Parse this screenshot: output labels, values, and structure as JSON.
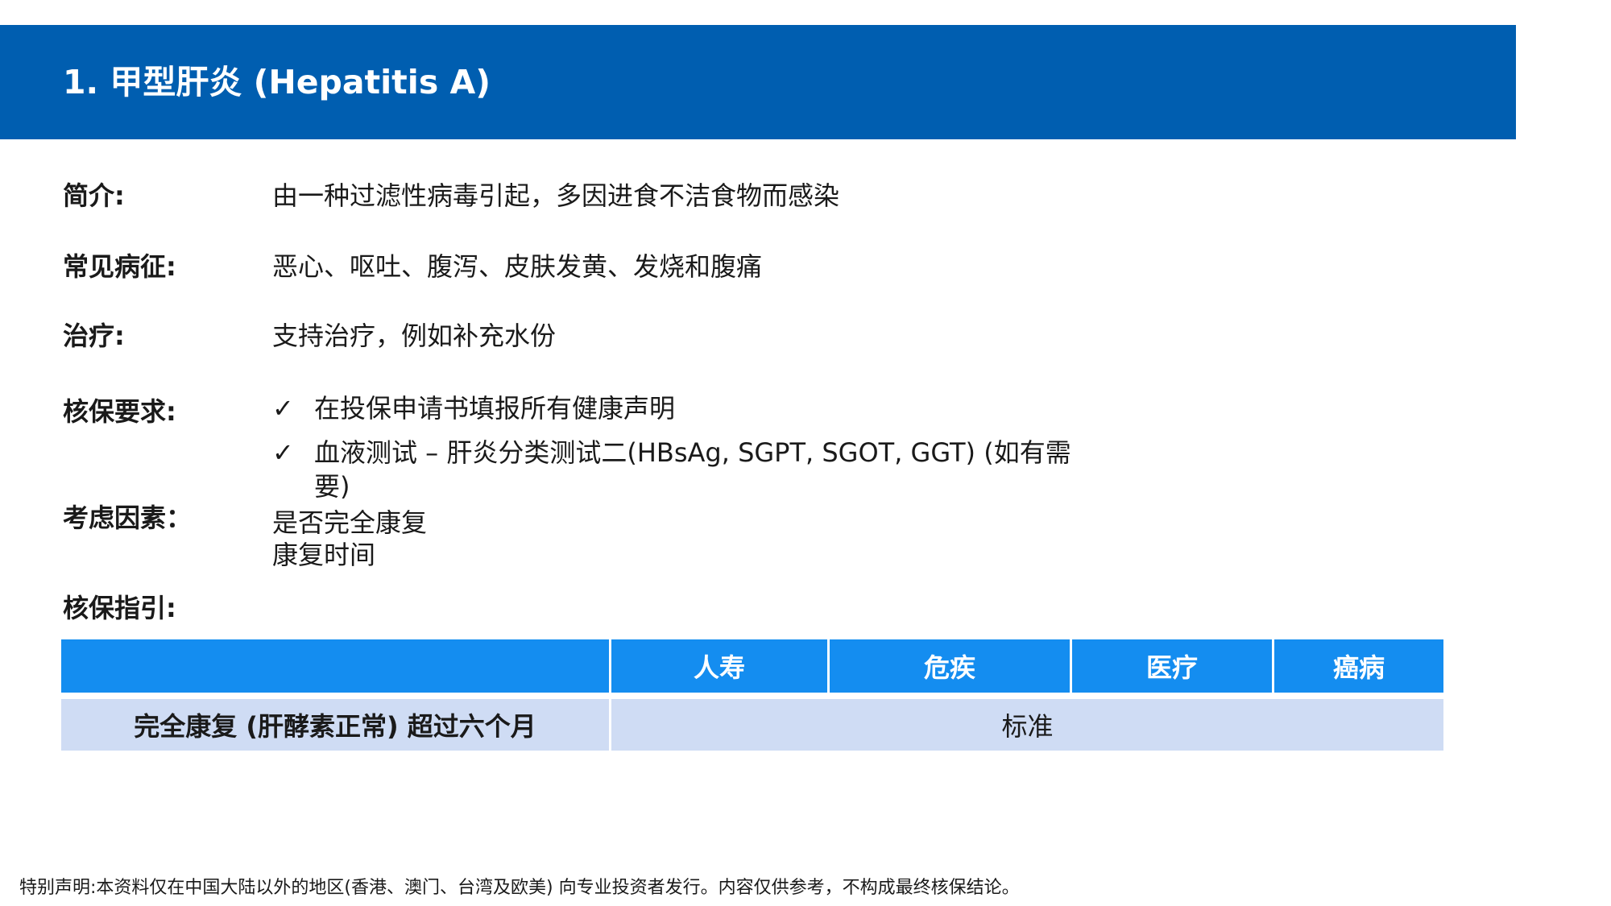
{
  "title": "1. 甲型肝炎 (Hepatitis A)",
  "sections": {
    "intro": {
      "label": "简介:",
      "value": "由一种过滤性病毒引起，多因进食不洁食物而感染"
    },
    "symptoms": {
      "label": "常见病征:",
      "value": "恶心、呕吐、腹泻、皮肤发黄、发烧和腹痛"
    },
    "treatment": {
      "label": "治疗:",
      "value": "支持治疗，例如补充水份"
    },
    "requirements": {
      "label": "核保要求:",
      "items": [
        "在投保申请书填报所有健康声明",
        "血液测试 – 肝炎分类测试二(HBsAg, SGPT, SGOT, GGT) (如有需要)"
      ]
    },
    "factors": {
      "label": "考虑因素：",
      "items": [
        "是否完全康复",
        "康复时间"
      ]
    },
    "guideline": {
      "label": "核保指引:"
    }
  },
  "tick_glyph": "✓",
  "table": {
    "headers": [
      "",
      "人寿",
      "危疾",
      "医疗",
      "癌病"
    ],
    "rows": [
      {
        "condition": "完全康复 (肝酵素正常) 超过六个月",
        "result": "标准"
      }
    ]
  },
  "colors": {
    "title_bar": "#005eb0",
    "table_header": "#148df0",
    "table_row": "#cfdcf4"
  },
  "footer": "特别声明:本资料仅在中国大陆以外的地区(香港、澳门、台湾及欧美) 向专业投资者发行。内容仅供参考，不构成最终核保结论。"
}
